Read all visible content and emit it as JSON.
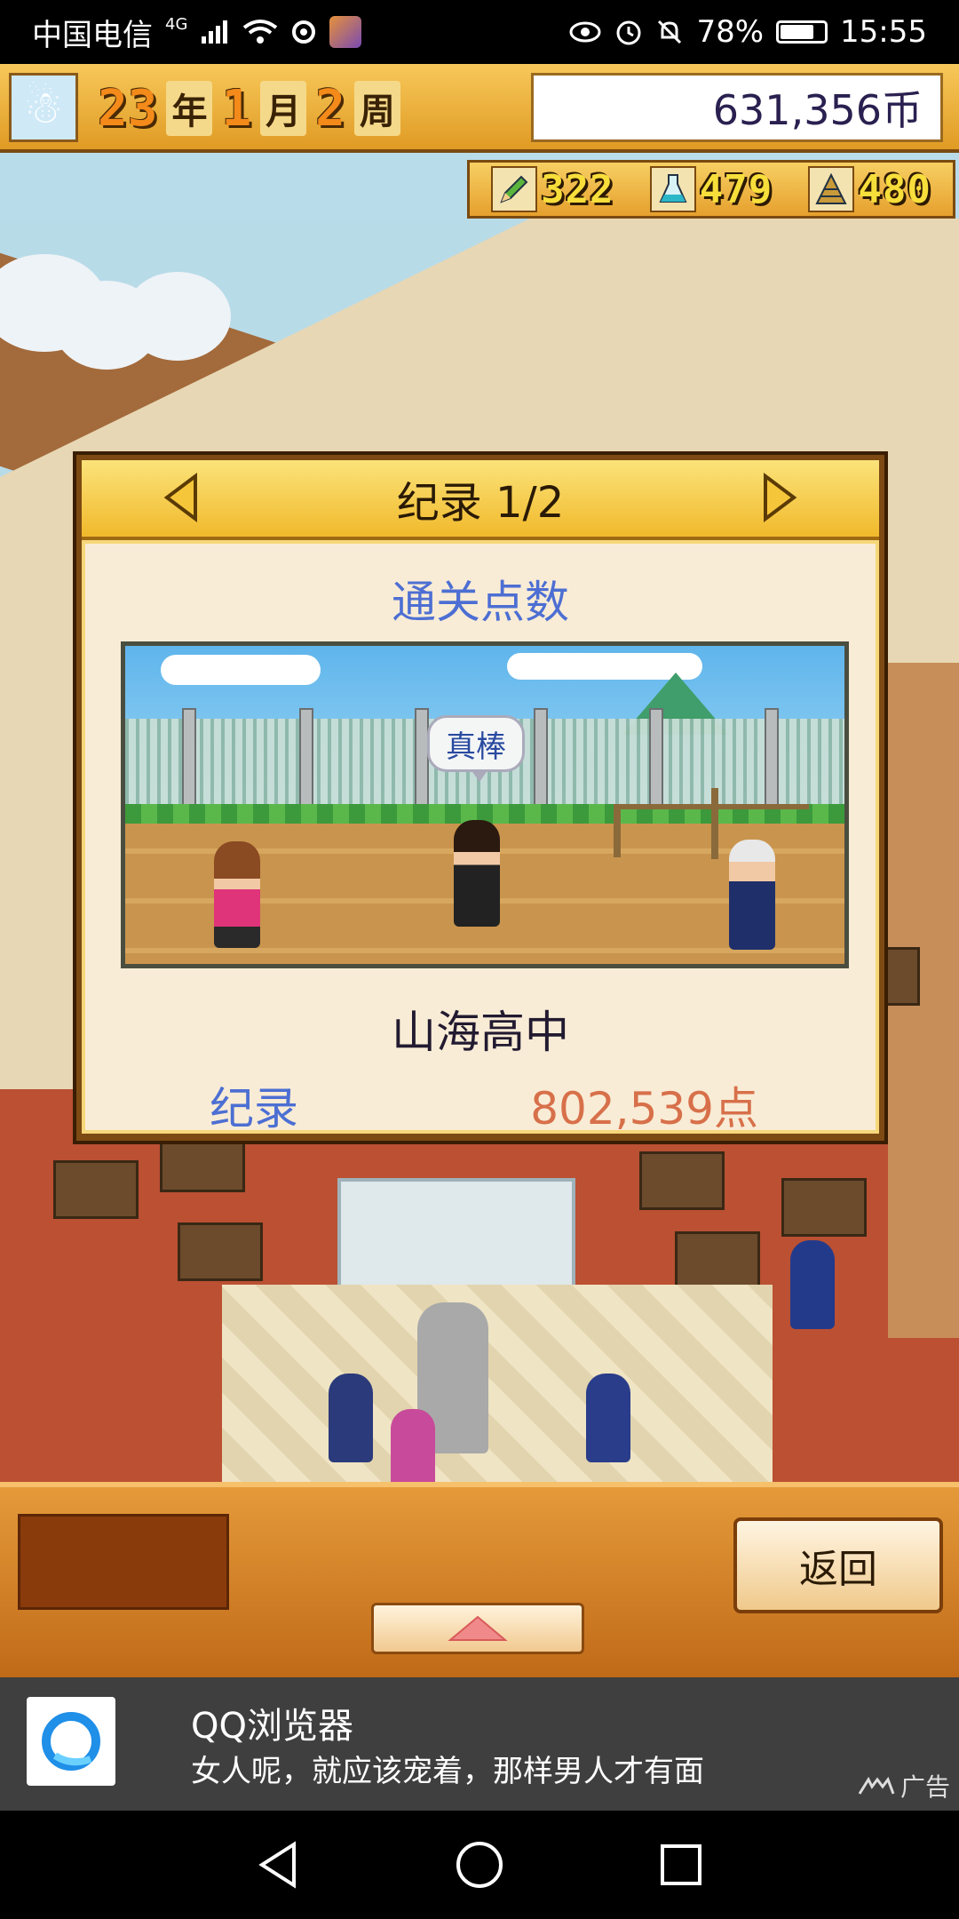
{
  "status_bar": {
    "carrier": "中国电信",
    "network": "4G",
    "battery": "78%",
    "battery_level": 0.78,
    "time": "15:55"
  },
  "top_bar": {
    "year": "23",
    "year_unit": "年",
    "month": "1",
    "month_unit": "月",
    "week": "2",
    "week_unit": "周",
    "money": "631,356币"
  },
  "resources": [
    {
      "icon": "pencil-icon",
      "value": "322"
    },
    {
      "icon": "flask-icon",
      "value": "479"
    },
    {
      "icon": "pyramid-icon",
      "value": "480"
    }
  ],
  "dialog": {
    "title": "纪录 1/2",
    "subtitle": "通关点数",
    "speech_bubble": "真棒",
    "school_name": "山海高中",
    "record_label": "纪录",
    "record_value": "802,539点"
  },
  "bottom": {
    "back_label": "返回"
  },
  "ad": {
    "app_name": "QQ浏览器",
    "text": "女人呢，就应该宠着，那样男人才有面",
    "tag": "广告"
  },
  "colors": {
    "accent_blue": "#4d6fd3",
    "record_orange": "#d7704a",
    "wood": "#c06a18"
  }
}
